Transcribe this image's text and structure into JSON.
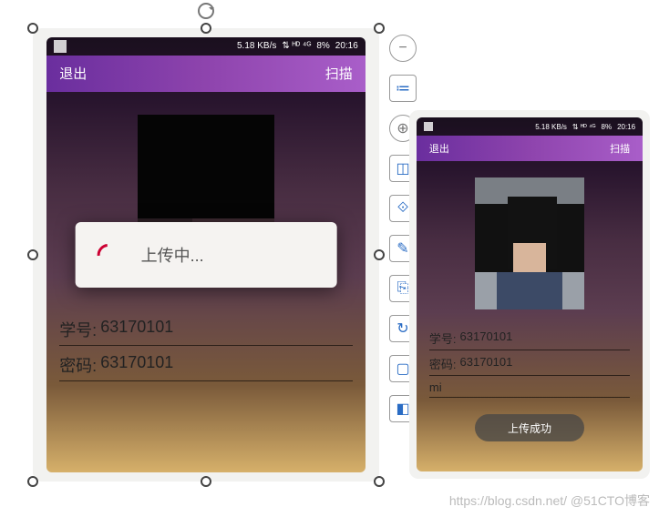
{
  "watermark": {
    "left": "https://blog.csdn.net/",
    "right": "@51CTO博客"
  },
  "toolbar": [
    "−",
    "≔",
    "⊕",
    "◫",
    "⟐",
    "✎",
    "⎘",
    "↻",
    "▢",
    "◧"
  ],
  "phone1": {
    "status": {
      "speed": "5.18 KB/s",
      "net": "⇅ ᴴᴰ ⁴ᴳ",
      "batt": "8%",
      "time": "20:16"
    },
    "topbar": {
      "left": "退出",
      "right": "扫描"
    },
    "fields": {
      "student_label": "学号:",
      "student_value": "63170101",
      "pass_label": "密码:",
      "pass_value": "63170101"
    },
    "dialog": {
      "text": "上传中..."
    }
  },
  "phone2": {
    "status": {
      "speed": "5.18 KB/s",
      "net": "⇅ ᴴᴰ ⁴ᴳ",
      "batt": "8%",
      "time": "20:16"
    },
    "topbar": {
      "left": "退出",
      "right": "扫描"
    },
    "fields": {
      "student_label": "学号:",
      "student_value": "63170101",
      "pass_label": "密码:",
      "pass_value": "63170101",
      "extra": "mi"
    },
    "toast": "上传成功"
  }
}
